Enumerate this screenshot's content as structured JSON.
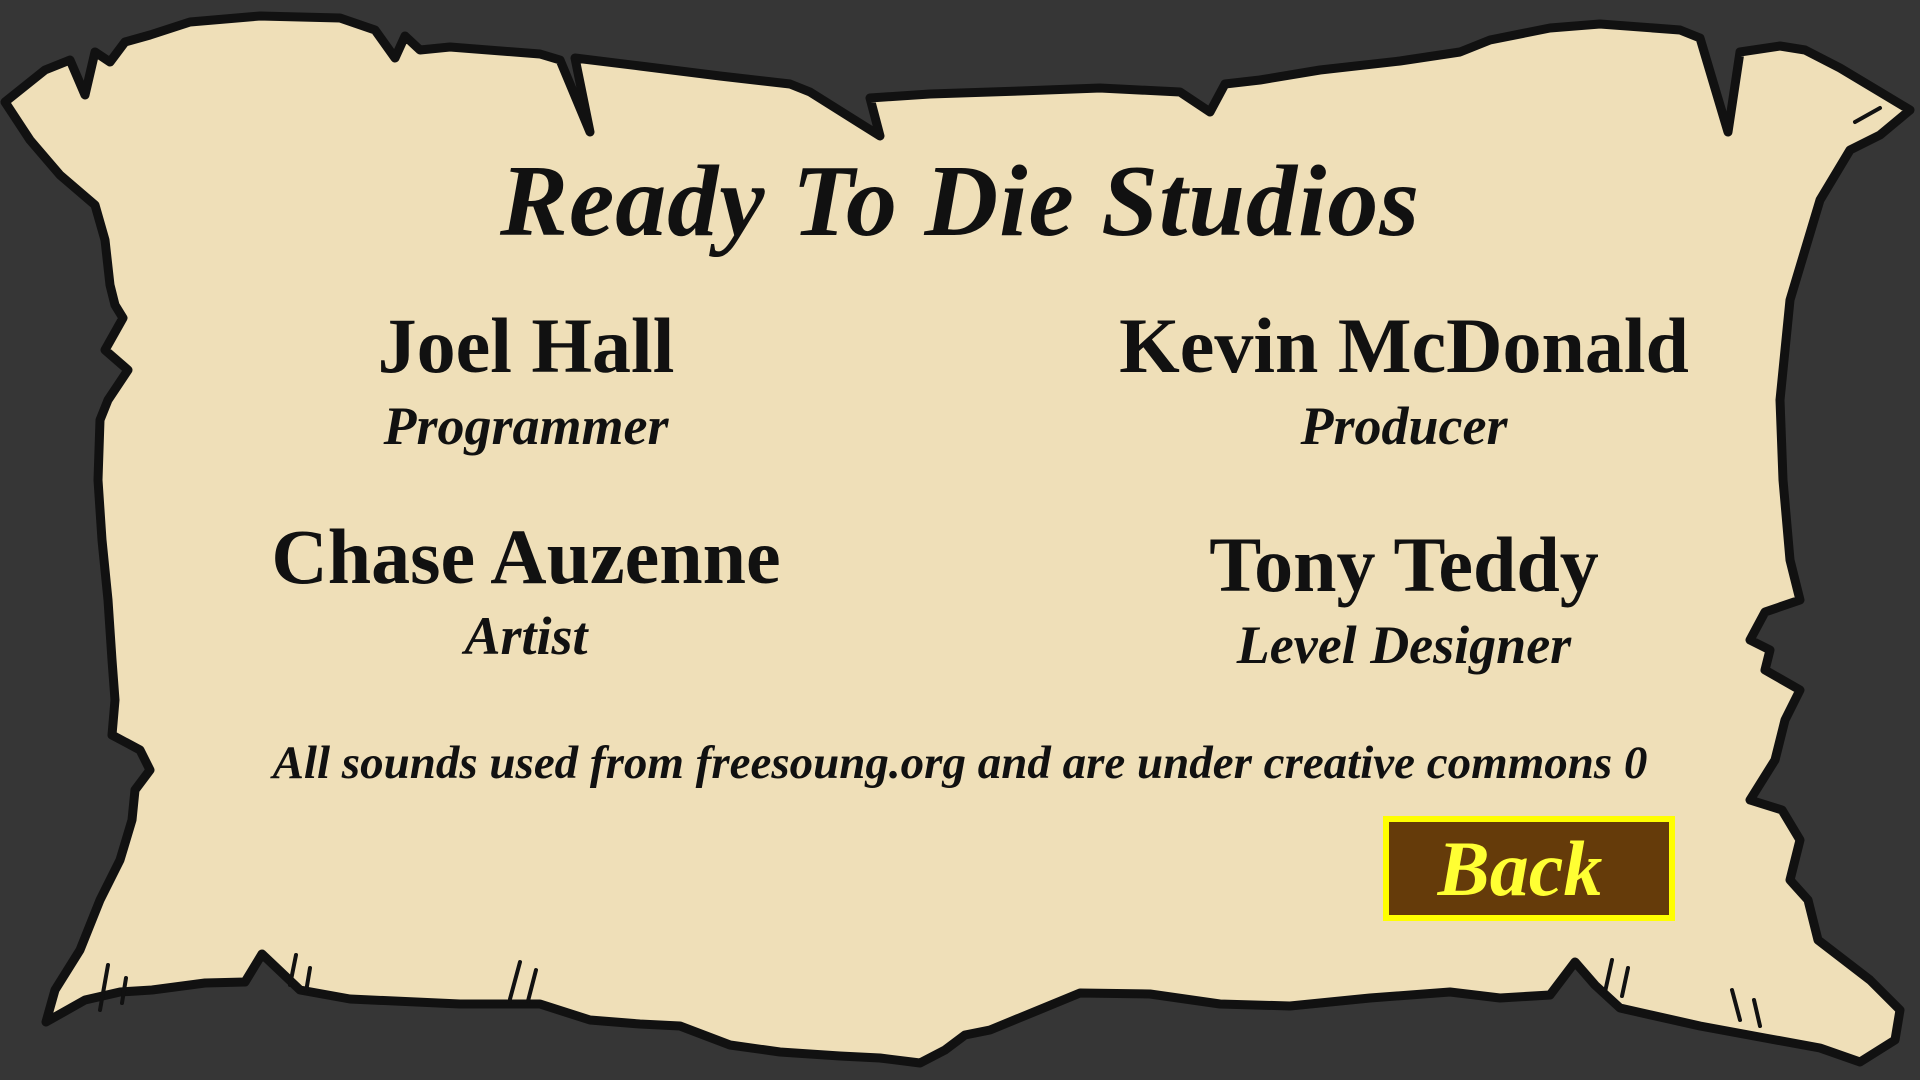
{
  "screen": "credits",
  "colors": {
    "background": "#363636",
    "parchment": "#efdfb8",
    "outline": "#111111",
    "button_fill": "#653b0a",
    "button_border": "#ffff00",
    "button_text": "#ffff33"
  },
  "credits": {
    "title": "Ready To Die Studios",
    "members": [
      {
        "name": "Joel Hall",
        "role": "Programmer"
      },
      {
        "name": "Kevin McDonald",
        "role": "Producer"
      },
      {
        "name": "Chase Auzenne",
        "role": "Artist"
      },
      {
        "name": "Tony Teddy",
        "role": "Level Designer"
      }
    ],
    "sound_note": "All sounds used from freesoung.org and are under creative commons 0"
  },
  "back_button": {
    "label": "Back"
  }
}
